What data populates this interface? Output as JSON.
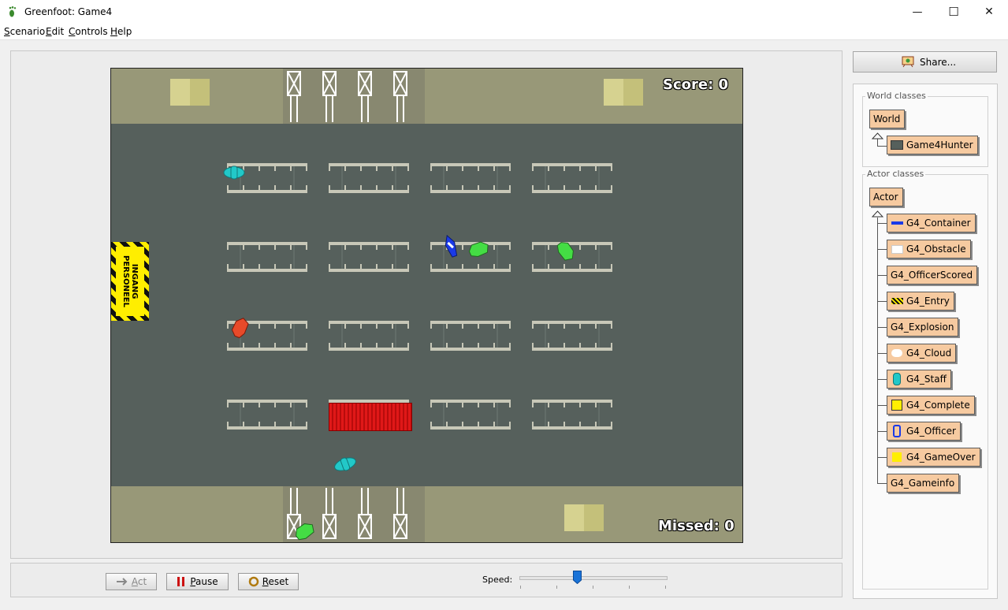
{
  "window": {
    "title": "Greenfoot: Game4",
    "minimize": "—",
    "maximize": "☐",
    "close": "✕"
  },
  "menu": [
    "Scenario",
    "Edit",
    "Controls",
    "Help"
  ],
  "world": {
    "score_text": "Score: 0",
    "missed_text": "Missed: 0",
    "entry_sign": [
      "INGANG",
      "PERSONEEL"
    ]
  },
  "controls": {
    "act_label": "Act",
    "pause_label": "Pause",
    "reset_label": "Reset",
    "speed_label": "Speed:",
    "speed_value": 0.4
  },
  "share": {
    "label": "Share..."
  },
  "world_classes": {
    "title": "World classes",
    "base": "World",
    "subclass": "Game4Hunter"
  },
  "actor_classes": {
    "title": "Actor classes",
    "base": "Actor",
    "items": [
      {
        "name": "G4_Container",
        "icon": "container-icon"
      },
      {
        "name": "G4_Obstacle",
        "icon": "obstacle-icon"
      },
      {
        "name": "G4_OfficerScored",
        "icon": ""
      },
      {
        "name": "G4_Entry",
        "icon": "entry-icon"
      },
      {
        "name": "G4_Explosion",
        "icon": ""
      },
      {
        "name": "G4_Cloud",
        "icon": "cloud-icon"
      },
      {
        "name": "G4_Staff",
        "icon": "staff-icon"
      },
      {
        "name": "G4_Complete",
        "icon": "complete-icon"
      },
      {
        "name": "G4_Officer",
        "icon": "officer-icon"
      },
      {
        "name": "G4_GameOver",
        "icon": "gameover-icon"
      },
      {
        "name": "G4_Gameinfo",
        "icon": ""
      }
    ]
  },
  "colors": {
    "floor": "#56605c",
    "wall": "#989878",
    "class_fill": "#f6caa0",
    "container_red": "#e01818",
    "staff_cyan": "#22c8c8",
    "cloud_green": "#44dd44",
    "officer_blue": "#1a3ae8",
    "explosion_red": "#e84a2a",
    "sign_yellow": "#ffee00"
  }
}
